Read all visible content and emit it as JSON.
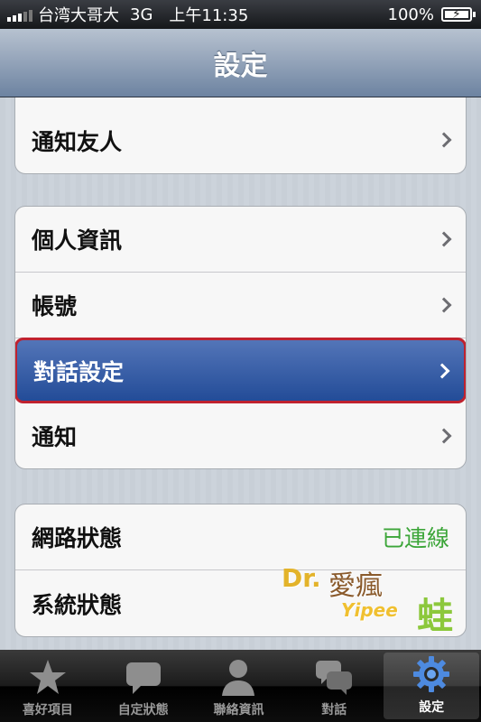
{
  "status_bar": {
    "carrier": "台湾大哥大",
    "network": "3G",
    "time": "上午11:35",
    "battery": "100%"
  },
  "nav": {
    "title": "設定"
  },
  "groups": [
    {
      "rows": [
        {
          "label": "通知友人"
        }
      ]
    },
    {
      "rows": [
        {
          "label": "個人資訊"
        },
        {
          "label": "帳號"
        },
        {
          "label": "對話設定"
        },
        {
          "label": "通知"
        }
      ]
    },
    {
      "rows": [
        {
          "label": "網路狀態",
          "value": "已連線"
        },
        {
          "label": "系統狀態"
        }
      ]
    }
  ],
  "watermark": {
    "dr": "Dr.",
    "text": "愛瘋",
    "yipee": "Yipee",
    "frog": "蛙"
  },
  "tabs": [
    {
      "label": "喜好項目",
      "icon": "star-icon"
    },
    {
      "label": "自定狀態",
      "icon": "speech-bubble-icon"
    },
    {
      "label": "聯絡資訊",
      "icon": "person-icon"
    },
    {
      "label": "對話",
      "icon": "chat-bubbles-icon"
    },
    {
      "label": "設定",
      "icon": "gear-icon"
    }
  ],
  "colors": {
    "selected_row": "#2b56a3",
    "selected_border": "#c0222f",
    "connected_text": "#3da63a"
  }
}
